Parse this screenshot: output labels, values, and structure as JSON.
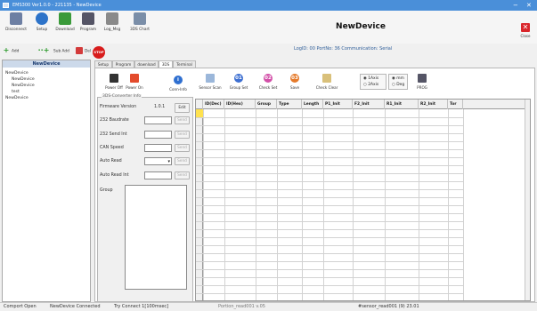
{
  "window": {
    "title": "EMS300 Ver1.0.0 - 221135 - NewDevice",
    "min": "−",
    "close": "✕"
  },
  "toolbar": {
    "buttons": [
      {
        "label": "Disconnect",
        "icon": "plug-icon",
        "color": "#6d7fa3"
      },
      {
        "label": "Setup",
        "icon": "setup-icon",
        "color": "#2d73c9"
      },
      {
        "label": "Download",
        "icon": "download-icon",
        "color": "#3a9a3a"
      },
      {
        "label": "Program",
        "icon": "program-icon",
        "color": "#555566"
      },
      {
        "label": "Log_Msg",
        "icon": "log-icon",
        "color": "#8a8a8a"
      },
      {
        "label": "3DS Chart",
        "icon": "chart-icon",
        "color": "#7a8ea8"
      }
    ],
    "title": "NewDevice",
    "close_label": "Close"
  },
  "edit_toolbar": {
    "add": "Add",
    "sub_add": "Sub Add",
    "del": "Del",
    "stop": "STOP"
  },
  "connection": "LogID: 00  PortNo: 36  Communication: Serial",
  "tree": {
    "header": "NewDevice",
    "nodes": [
      "NewDevice",
      "NewDevice",
      "NewDevice",
      "test",
      "NewDevice"
    ]
  },
  "tabs": [
    "Setup",
    "Program",
    "download",
    "3DS",
    "Terminal"
  ],
  "active_tab": 3,
  "panel_toolbar": {
    "power_off": "Power Off",
    "power_on": "Power On",
    "conn_info": "Conn-Info",
    "sensor_scan": "Sensor Scan",
    "group_set": "Group Set",
    "check_set": "Check Set",
    "save": "Save",
    "check_clear": "Check Clear",
    "prog": "PROG",
    "radio_1": "1Axis",
    "radio_2": "2Axis",
    "radio_3": "mm",
    "radio_4": "Deg"
  },
  "config": {
    "legend": "3DS-Converter Info",
    "firmware_label": "Firmware Version",
    "firmware_value": "1.0.1",
    "edit": "Edit",
    "rows": [
      "232 Baudrate",
      "232 Send Int",
      "CAN Speed",
      "Auto Read",
      "Auto Read Int"
    ],
    "send": "Send",
    "group": "Group"
  },
  "grid": {
    "columns": [
      "ID(Dec)",
      "ID(Hex)",
      "Group",
      "Type",
      "Length",
      "P1_Init",
      "F2_Init",
      "R1_Init",
      "R2_Init",
      "Tor"
    ]
  },
  "status": {
    "port": "Comport Open",
    "device": "NewDevice Connected",
    "retry": "Try Connect 1[100msec]",
    "middle": "Portion_read001 v.05",
    "right": "#sensor_read001 (9) 23.01"
  }
}
